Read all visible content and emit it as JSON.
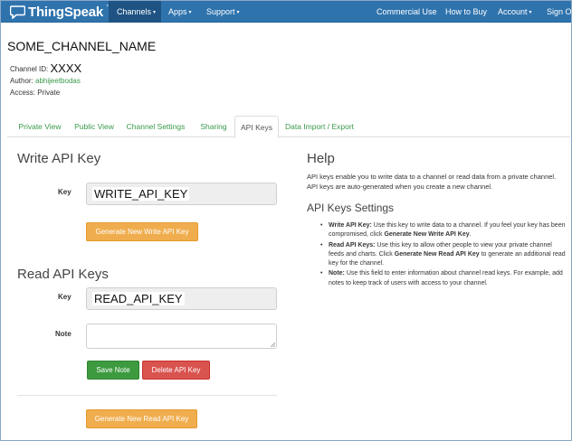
{
  "navbar": {
    "brand": "ThingSpeak",
    "brand_tm": "™",
    "left_menu": [
      {
        "label": "Channels",
        "caret": "▾"
      },
      {
        "label": "Apps",
        "caret": "▾"
      },
      {
        "label": "Support",
        "caret": "▾"
      }
    ],
    "right_menu": [
      {
        "label": "Commercial Use"
      },
      {
        "label": "How to Buy"
      },
      {
        "label": "Account",
        "caret": "▾"
      },
      {
        "label": "Sign Ou"
      }
    ],
    "colors": {
      "bar": "#2f73ad",
      "active": "#1e5384"
    }
  },
  "channel": {
    "name": "SOME_CHANNEL_NAME",
    "id_label": "Channel ID:",
    "id_value": "XXXX",
    "author_label": "Author:",
    "author_value": "abhijeetbodas",
    "access_label": "Access:",
    "access_value": "Private"
  },
  "tabs": [
    {
      "label": "Private View"
    },
    {
      "label": "Public View"
    },
    {
      "label": "Channel Settings"
    },
    {
      "label": "Sharing"
    },
    {
      "label": "API Keys",
      "active": true
    },
    {
      "label": "Data Import / Export"
    }
  ],
  "write_section": {
    "title": "Write API Key",
    "key_label": "Key",
    "key_value": "WRITE_API_KEY",
    "generate_button": "Generate New Write API Key"
  },
  "read_section": {
    "title": "Read API Keys",
    "key_label": "Key",
    "key_value": "READ_API_KEY",
    "note_label": "Note",
    "note_value": "",
    "save_button": "Save Note",
    "delete_button": "Delete API Key",
    "generate_button": "Generate New Read API Key"
  },
  "help": {
    "title": "Help",
    "intro": "API keys enable you to write data to a channel or read data from a private channel. API keys are auto-generated when you create a new channel.",
    "settings_title": "API Keys Settings",
    "items": [
      {
        "term": "Write API Key:",
        "text": " Use this key to write data to a channel. If you feel your key has been compromised, click ",
        "action": "Generate New Write API Key",
        "tail": "."
      },
      {
        "term": "Read API Keys:",
        "text": " Use this key to allow other people to view your private channel feeds and charts. Click ",
        "action": "Generate New Read API Key",
        "tail": " to generate an additional read key for the channel."
      },
      {
        "term": "Note:",
        "text": " Use this field to enter information about channel read keys. For example, add notes to keep track of users with access to your channel.",
        "action": "",
        "tail": ""
      }
    ]
  },
  "icons": {
    "logo": "thingspeak-logo-icon",
    "caret": "chevron-down-icon",
    "grip": "resize-grip-icon"
  },
  "colors": {
    "link_green": "#3a9a4a",
    "btn_orange": "#f0ad4e",
    "btn_green": "#3d9a3f",
    "btn_red": "#d9534f"
  }
}
